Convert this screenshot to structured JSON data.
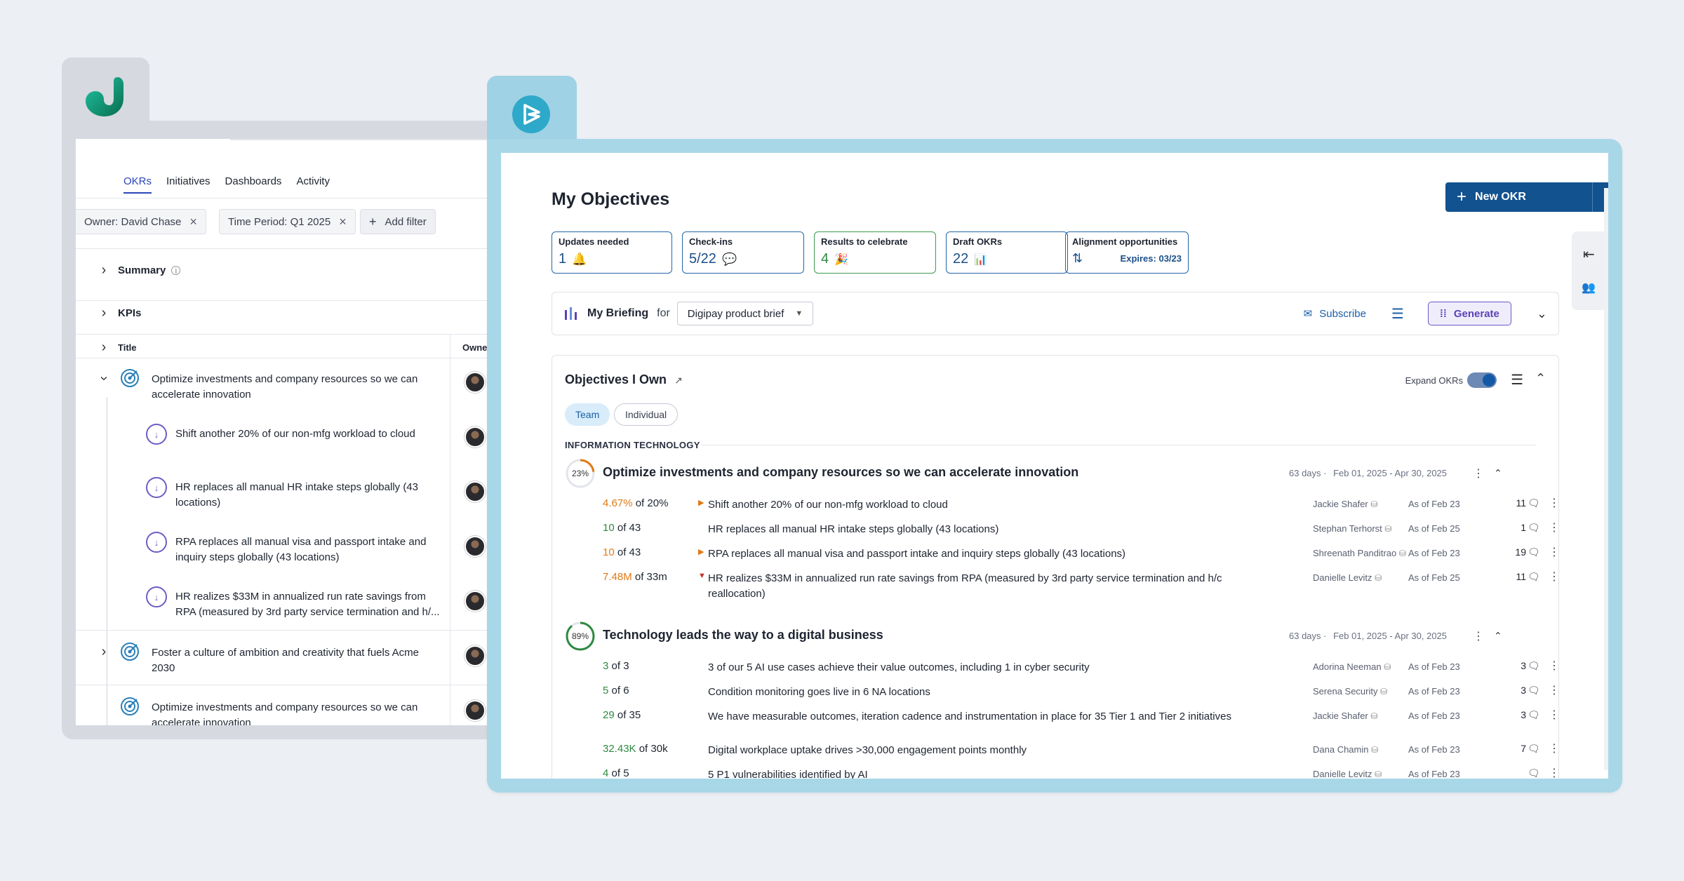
{
  "back_window": {
    "tabs": [
      "OKRs",
      "Initiatives",
      "Dashboards",
      "Activity"
    ],
    "filters": [
      "Owner: David Chase",
      "Time Period: Q1 2025"
    ],
    "add_filter": "Add filter",
    "summary": "Summary",
    "kpis": "KPIs",
    "col_title": "Title",
    "col_owner": "Owner",
    "items": [
      {
        "type": "objective",
        "text": "Optimize investments and company resources so we can accelerate innovation"
      },
      {
        "type": "kr",
        "text": "Shift another 20% of our non-mfg workload to cloud"
      },
      {
        "type": "kr",
        "text": "HR replaces all manual HR intake steps globally (43 locations)"
      },
      {
        "type": "kr",
        "text": "RPA replaces all manual visa and passport intake and inquiry steps globally (43 locations)"
      },
      {
        "type": "kr",
        "text": "HR realizes $33M in annualized run rate savings from RPA (measured by 3rd party service termination and h/..."
      },
      {
        "type": "objective",
        "text": "Foster a culture of ambition and creativity that fuels Acme 2030"
      },
      {
        "type": "objective",
        "text": "Optimize investments and company resources so we can accelerate innovation"
      }
    ]
  },
  "front_window": {
    "title": "My Objectives",
    "new_okr": "New OKR",
    "cards": [
      {
        "label": "Updates needed",
        "value": "1",
        "icon": "bell-add-icon"
      },
      {
        "label": "Check-ins",
        "value": "5/22",
        "icon": "chat-icon"
      },
      {
        "label": "Results to celebrate",
        "value": "4",
        "icon": "party-icon"
      },
      {
        "label": "Draft OKRs",
        "value": "22",
        "icon": "chart-icon"
      },
      {
        "label": "Alignment opportunities",
        "value": "",
        "icon": "sort-arrows-icon",
        "expires": "Expires: 03/23"
      }
    ],
    "briefing": {
      "label": "My Briefing",
      "for": "for",
      "selected": "Digipay product brief",
      "subscribe": "Subscribe",
      "generate": "Generate"
    },
    "objectives_own": {
      "title": "Objectives I Own",
      "expand_label": "Expand OKRs",
      "pills": [
        "Team",
        "Individual"
      ],
      "section": "INFORMATION TECHNOLOGY",
      "objectives": [
        {
          "progress": 23,
          "progress_label": "23%",
          "title": "Optimize investments and company resources so we can accelerate innovation",
          "days": "63 days",
          "range": "Feb 01, 2025 - Apr 30, 2025",
          "krs": [
            {
              "cur": "4.67%",
              "tgt": "of 20%",
              "status": "orange",
              "arrow": "▶",
              "title": "Shift another 20% of our non-mfg workload to cloud",
              "owner": "Jackie Shafer",
              "asof": "As of Feb 23",
              "count": "11"
            },
            {
              "cur": "10",
              "tgt": "of 43",
              "status": "green",
              "arrow": "",
              "title": "HR replaces all manual HR intake steps globally (43 locations)",
              "owner": "Stephan Terhorst",
              "asof": "As of Feb 25",
              "count": "1"
            },
            {
              "cur": "10",
              "tgt": "of 43",
              "status": "orange",
              "arrow": "▶",
              "title": "RPA replaces all manual visa and passport intake and inquiry steps globally (43 locations)",
              "owner": "Shreenath Panditrao",
              "asof": "As of Feb 23",
              "count": "19"
            },
            {
              "cur": "7.48M",
              "tgt": "of 33m",
              "status": "orange",
              "arrow": "▼",
              "title": "HR realizes $33M in annualized run rate savings from RPA (measured by 3rd party service termination and h/c reallocation)",
              "owner": "Danielle Levitz",
              "asof": "As of Feb 25",
              "count": "11"
            }
          ]
        },
        {
          "progress": 89,
          "progress_label": "89%",
          "title": "Technology leads the way to a digital business",
          "days": "63 days",
          "range": "Feb 01, 2025 - Apr 30, 2025",
          "krs": [
            {
              "cur": "3",
              "tgt": "of 3",
              "status": "green",
              "arrow": "",
              "title": "3 of our 5 AI use cases achieve their value outcomes, including 1 in cyber security",
              "owner": "Adorina Neeman",
              "asof": "As of Feb 23",
              "count": "3"
            },
            {
              "cur": "5",
              "tgt": "of 6",
              "status": "green",
              "arrow": "",
              "title": "Condition monitoring goes live in 6 NA locations",
              "owner": "Serena Security",
              "asof": "As of Feb 23",
              "count": "3"
            },
            {
              "cur": "29",
              "tgt": "of 35",
              "status": "green",
              "arrow": "",
              "title": "We have measurable outcomes, iteration cadence and instrumentation in place for 35 Tier 1 and Tier 2 initiatives",
              "owner": "Jackie Shafer",
              "asof": "As of Feb 23",
              "count": "3"
            },
            {
              "cur": "32.43K",
              "tgt": "of 30k",
              "status": "green",
              "arrow": "",
              "title": "Digital workplace uptake drives >30,000 engagement points monthly",
              "owner": "Dana Chamin",
              "asof": "As of Feb 23",
              "count": "7"
            },
            {
              "cur": "4",
              "tgt": "of 5",
              "status": "green",
              "arrow": "",
              "title": "5 P1 vulnerabilities identified by AI",
              "owner": "Danielle Levitz",
              "asof": "As of Feb 23",
              "count": ""
            }
          ]
        }
      ]
    }
  },
  "colors": {
    "brand": "#12528f",
    "on_track": "#2e8a40",
    "at_risk": "#e07a16",
    "ai_purple": "#6d55c9"
  }
}
